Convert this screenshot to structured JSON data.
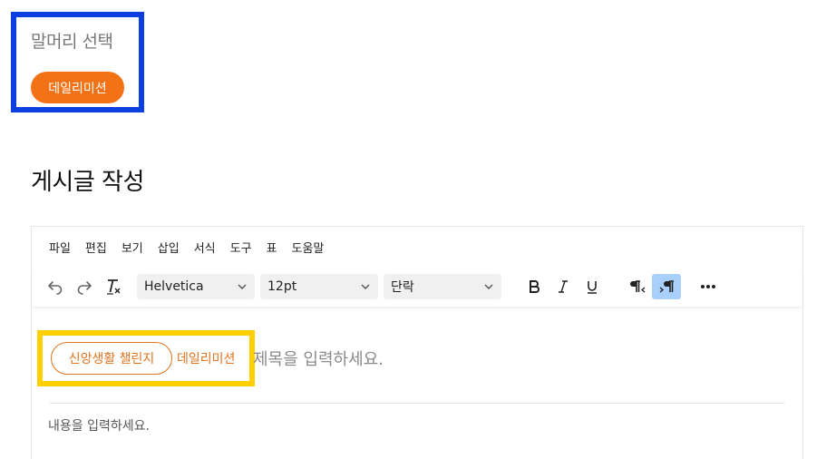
{
  "prefix": {
    "title": "말머리 선택",
    "selected": "데일리미션"
  },
  "page_title": "게시글 작성",
  "editor": {
    "menu": [
      "파일",
      "편집",
      "보기",
      "삽입",
      "서식",
      "도구",
      "표",
      "도움말"
    ],
    "toolbar": {
      "font_family": "Helvetica",
      "font_size": "12pt",
      "block_format": "단락"
    },
    "title_row": {
      "challenge_chip": "신앙생활 챌린지",
      "daily_label": "데일리미션",
      "title_placeholder": "제목을 입력하세요."
    },
    "content_placeholder": "내용을 입력하세요."
  },
  "colors": {
    "accent": "#f47216",
    "focus_blue": "#0b3fe0",
    "focus_yellow": "#ffcf00",
    "active_btn": "#a9cffb"
  }
}
